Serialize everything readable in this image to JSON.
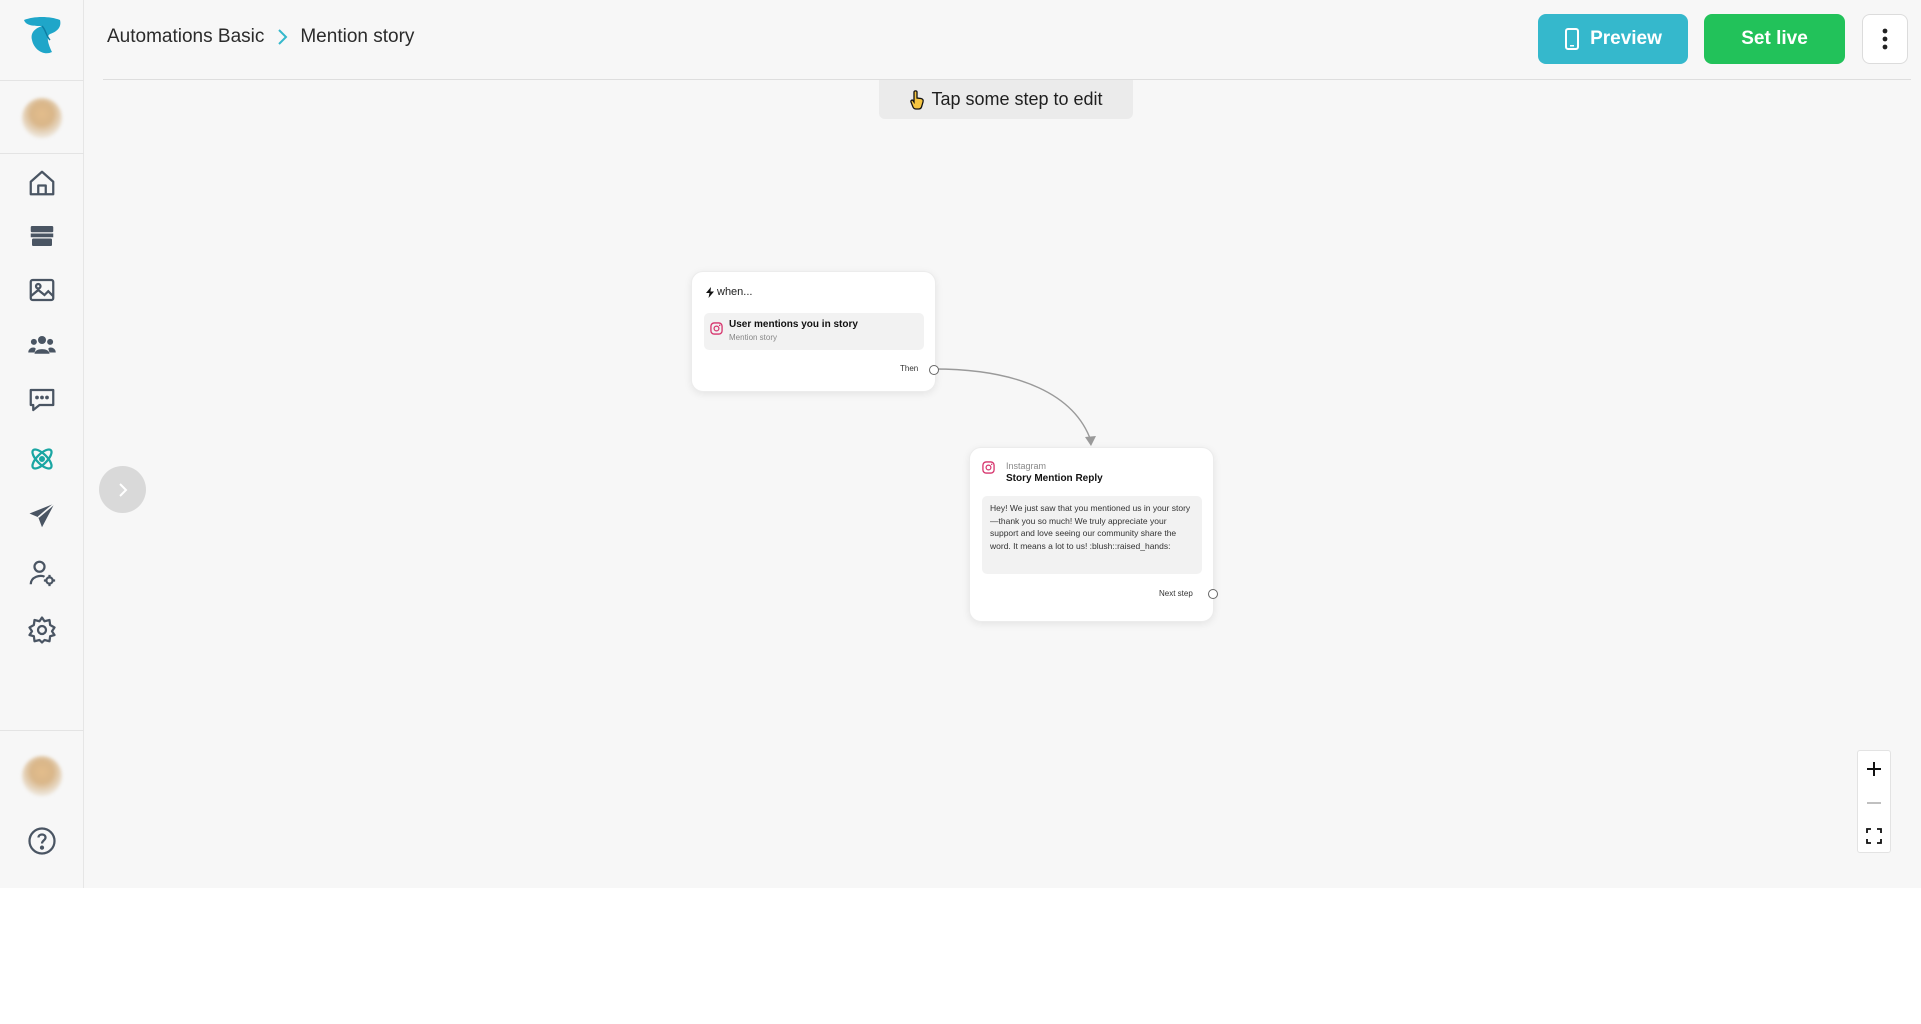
{
  "breadcrumb": {
    "parent": "Automations Basic",
    "current": "Mention story"
  },
  "header": {
    "preview_label": "Preview",
    "set_live_label": "Set live"
  },
  "canvas": {
    "hint": "Tap some step to edit",
    "trigger_card": {
      "heading": "when...",
      "title": "User mentions you in story",
      "subtitle": "Mention story",
      "port_label": "Then"
    },
    "action_card": {
      "platform": "Instagram",
      "title": "Story Mention Reply",
      "message": "Hey! We just saw that you mentioned us in your story—thank you so much! We truly appreciate your support and love seeing our community share the word. It means a lot to us! :blush::raised_hands:",
      "port_label": "Next step"
    }
  },
  "sidebar": {
    "items": [
      "home-icon",
      "store-icon",
      "image-icon",
      "users-icon",
      "chat-icon",
      "atom-icon",
      "send-icon",
      "user-settings-icon",
      "settings-icon",
      "help-icon"
    ]
  },
  "colors": {
    "accent_teal": "#35b8cc",
    "live_green": "#22c25a",
    "active_icon": "#1aa6a3",
    "icon": "#4a5563"
  }
}
